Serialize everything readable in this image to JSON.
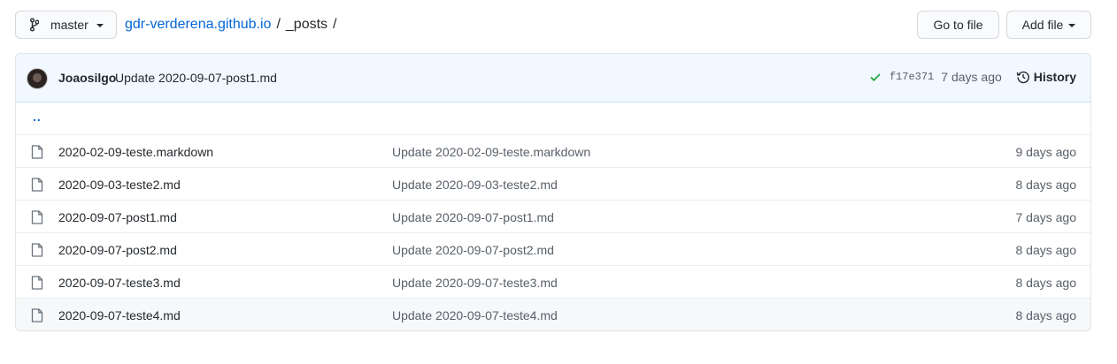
{
  "branch": {
    "name": "master"
  },
  "breadcrumb": {
    "repo": "gdr-verderena.github.io",
    "separator": "/",
    "folder": "_posts",
    "trailing": "/"
  },
  "actions": {
    "go_to_file": "Go to file",
    "add_file": "Add file"
  },
  "latest_commit": {
    "author": "Joaosilgo",
    "message": "Update 2020-09-07-post1.md",
    "sha": "f17e371",
    "time": "7 days ago",
    "history": "History"
  },
  "parent_dir": "..",
  "files": [
    {
      "name": "2020-02-09-teste.markdown",
      "commit": "Update 2020-02-09-teste.markdown",
      "age": "9 days ago"
    },
    {
      "name": "2020-09-03-teste2.md",
      "commit": "Update 2020-09-03-teste2.md",
      "age": "8 days ago"
    },
    {
      "name": "2020-09-07-post1.md",
      "commit": "Update 2020-09-07-post1.md",
      "age": "7 days ago"
    },
    {
      "name": "2020-09-07-post2.md",
      "commit": "Update 2020-09-07-post2.md",
      "age": "8 days ago"
    },
    {
      "name": "2020-09-07-teste3.md",
      "commit": "Update 2020-09-07-teste3.md",
      "age": "8 days ago"
    },
    {
      "name": "2020-09-07-teste4.md",
      "commit": "Update 2020-09-07-teste4.md",
      "age": "8 days ago"
    }
  ],
  "colors": {
    "link": "#0366d6",
    "commit_bar_bg": "#f1f8ff",
    "check": "#28a745",
    "muted": "#586069"
  }
}
